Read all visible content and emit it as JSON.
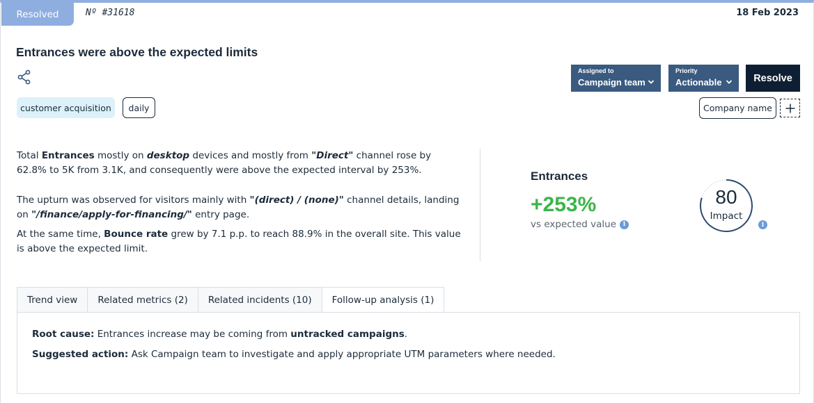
{
  "header": {
    "status": "Resolved",
    "incident_number": "Nº #31618",
    "date": "18 Feb 2023"
  },
  "title": "Entrances were above the expected limits",
  "tags": [
    "customer acquisition",
    "daily"
  ],
  "controls": {
    "assigned_label": "Assigned to",
    "assigned_value": "Campaign team",
    "priority_label": "Priority",
    "priority_value": "Actionable",
    "resolve_label": "Resolve",
    "company_name": "Company name"
  },
  "description": {
    "p1": {
      "t1": "Total ",
      "metric": "Entrances",
      "t2": " mostly on ",
      "device": "desktop",
      "t3": " devices and mostly from ",
      "channel": "\"Direct\"",
      "t4": " channel rose by 62.8% to 5K from 3.1K, and consequently were above the expected interval by 253%."
    },
    "p2": {
      "t1": "The upturn was observed for visitors mainly with ",
      "channel_details": "\"(direct) / (none)\"",
      "t2": " channel details, landing on ",
      "entry_page": "\"/finance/apply-for-financing/\"",
      "t3": " entry page."
    },
    "p3": {
      "t1": "At the same time, ",
      "metric": "Bounce rate",
      "t2": " grew by 7.1 p.p. to reach 88.9% in the overall site. This value is above the expected limit."
    }
  },
  "metric": {
    "name": "Entrances",
    "change": "+253%",
    "sub": "vs expected value",
    "impact_value": "80",
    "impact_label": "Impact",
    "impact_score": 80,
    "accent_color": "#3bb54a"
  },
  "tabs": [
    {
      "label": "Trend view",
      "active": false
    },
    {
      "label": "Related metrics (2)",
      "active": false
    },
    {
      "label": "Related incidents (10)",
      "active": false
    },
    {
      "label": "Follow-up analysis (1)",
      "active": true
    }
  ],
  "analysis": {
    "root_cause_label": "Root cause:",
    "root_cause_text": " Entrances increase may be coming from ",
    "root_cause_bold": "untracked campaigns",
    "root_cause_end": ".",
    "action_label": "Suggested action:",
    "action_text": " Ask Campaign team to investigate and apply appropriate UTM parameters where needed."
  },
  "icons": {
    "share": "share-icon",
    "chevron": "chevron-down-icon",
    "info": "info-icon",
    "add": "plus-icon"
  }
}
